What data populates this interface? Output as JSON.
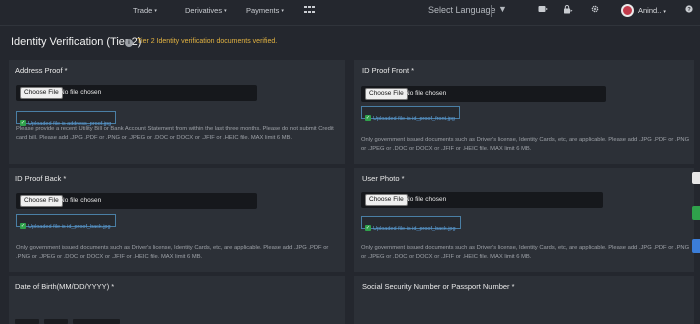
{
  "nav": {
    "trade": "Trade",
    "derivatives": "Derivatives",
    "payments": "Payments",
    "select_language": "Select Language",
    "user_name": "Anind..",
    "caret": "▾"
  },
  "page": {
    "title": "Identity Verification (Tier 2)",
    "info_icon": "i",
    "tier_note": "Tier 2 Identity verification documents verified."
  },
  "cards": [
    {
      "label": "Address Proof *",
      "choose_label": "Choose File",
      "file_status": "No file chosen",
      "uploaded": "Uploaded file is address_proof.jpg",
      "help": "Please provide a recent Utility Bill or Bank Account Statement from within the last three months. Please do not submit Credit card bill. Please add .JPG .PDF or .PNG or .JPEG or .DOC or DOCX or .JFIF or .HEIC file. MAX limit 6 MB."
    },
    {
      "label": "ID Proof Front *",
      "choose_label": "Choose File",
      "file_status": "No file chosen",
      "uploaded": "Uploaded file is id_proof_front.jpg",
      "help": "Only government issued documents such as Driver's license, Identity Cards, etc, are applicable. Please add .JPG .PDF or .PNG or .JPEG or .DOC or DOCX or .JFIF or .HEIC file. MAX limit 6 MB."
    },
    {
      "label": "ID Proof Back *",
      "choose_label": "Choose File",
      "file_status": "No file chosen",
      "uploaded": "Uploaded file is id_proof_back.jpg",
      "help": "Only government issued documents such as Driver's license, Identity Cards, etc, are applicable. Please add .JPG .PDF or .PNG or .JPEG or .DOC or DOCX or .JFIF or .HEIC file. MAX limit 6 MB."
    },
    {
      "label": "User Photo *",
      "choose_label": "Choose File",
      "file_status": "No file chosen",
      "uploaded": "Uploaded file is id_proof_back.jpg",
      "help": "Only government issued documents such as Driver's license, Identity Cards, etc, are applicable. Please add .JPG .PDF or .PNG or .JPEG or .DOC or DOCX or .JFIF or .HEIC file. MAX limit 6 MB."
    },
    {
      "label": "Date of Birth(MM/DD/YYYY) *"
    },
    {
      "label": "Social Security Number or Passport Number *"
    }
  ],
  "colors": {
    "background": "#24272e",
    "card": "#2c3037",
    "tier_note": "#e3b341",
    "upload_link": "#5b9bd5",
    "check": "#2fa14b"
  },
  "icons": [
    "grid-icon",
    "wallet-icon",
    "lock-icon",
    "gear-icon",
    "avatar",
    "help-icon",
    "check-icon",
    "info-icon"
  ]
}
